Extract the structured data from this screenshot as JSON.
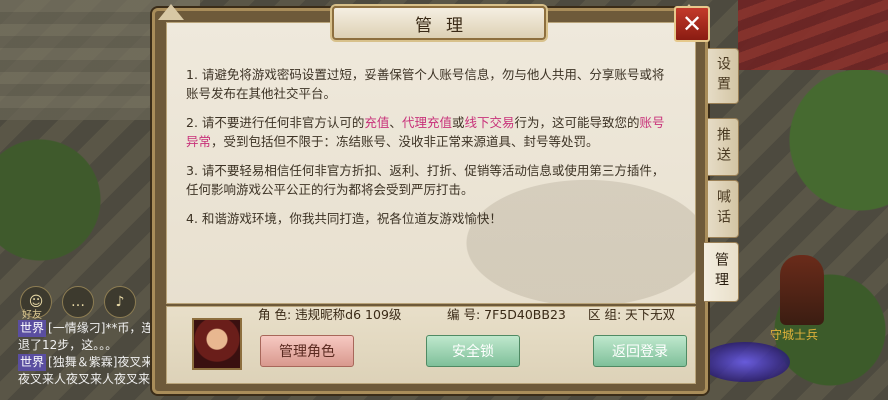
{
  "dialog": {
    "title": "管理",
    "close_label": "✕",
    "rules": [
      {
        "parts": [
          {
            "t": "1. 请避免将游戏密码设置过短，妥善保管个人账号信息，勿与他人共用、分享账号或将账号发布在其他社交平台。"
          }
        ]
      },
      {
        "parts": [
          {
            "t": "2. 请不要进行任何非官方认可的"
          },
          {
            "t": "充值",
            "hl": true
          },
          {
            "t": "、"
          },
          {
            "t": "代理充值",
            "hl": true
          },
          {
            "t": "或"
          },
          {
            "t": "线下交易",
            "hl": true
          },
          {
            "t": "行为，这可能导致您的"
          },
          {
            "t": "账号异常",
            "hl": true
          },
          {
            "t": "，受到包括但不限于：冻结账号、没收非正常来源道具、封号等处罚。"
          }
        ]
      },
      {
        "parts": [
          {
            "t": "3. 请不要轻易相信任何非官方折扣、返利、打折、促销等活动信息或使用第三方插件，任何影响游戏公平公正的行为都将会受到严厉打击。"
          }
        ]
      },
      {
        "parts": [
          {
            "t": "4. 和谐游戏环境，你我共同打造，祝各位道友游戏愉快！"
          }
        ]
      }
    ],
    "role": {
      "label": "角  色:",
      "value": "违规昵称d6 109级"
    },
    "code": {
      "label": "编  号:",
      "value": "7F5D40BB23"
    },
    "zone": {
      "label": "区  组:",
      "value": "天下无双"
    },
    "buttons": {
      "manage_role": "管理角色",
      "security_lock": "安全锁",
      "return_login": "返回登录"
    }
  },
  "tabs": [
    "设置",
    "推送",
    "喊话",
    "管理"
  ],
  "active_tab": "管理",
  "scene": {
    "guard_name": "守城士兵",
    "friend_label": "好友",
    "chat_lines": [
      {
        "tag": "世界",
        "text": "[一情缘刁]**币，连"
      },
      {
        "tag": "",
        "text": "退了12步，这。。。"
      },
      {
        "tag": "世界",
        "text": "[独舞＆紫霖]夜叉来"
      },
      {
        "tag": "",
        "text": "夜叉来人夜叉来人夜叉来人"
      }
    ],
    "chat_icons": [
      "friend-icon",
      "chat-bubble-icon",
      "microphone-icon"
    ]
  },
  "colors": {
    "highlight": "#c8327a",
    "close_red": "#c33a2a"
  }
}
